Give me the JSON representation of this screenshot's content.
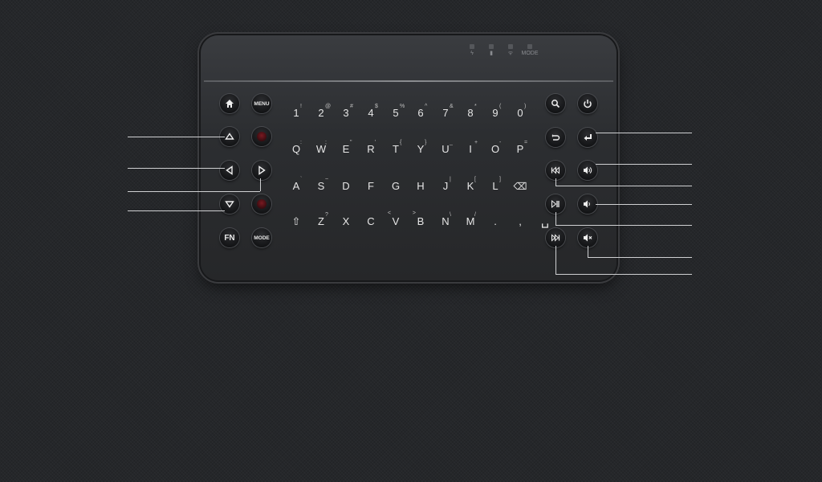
{
  "indicators": [
    {
      "name": "power-led",
      "icon": "plug"
    },
    {
      "name": "battery-led",
      "icon": "battery"
    },
    {
      "name": "wifi-led",
      "icon": "wifi"
    },
    {
      "name": "mode-led",
      "label": "MODE"
    }
  ],
  "left_buttons": {
    "home": "⌂",
    "menu": "MENU",
    "up": "",
    "down": "",
    "left": "",
    "right": "",
    "fn": "FN",
    "mode": "MODE"
  },
  "keyboard": {
    "row1": [
      {
        "k": "1",
        "s": "!"
      },
      {
        "k": "2",
        "s": "@"
      },
      {
        "k": "3",
        "s": "#"
      },
      {
        "k": "4",
        "s": "$"
      },
      {
        "k": "5",
        "s": "%"
      },
      {
        "k": "6",
        "s": "^"
      },
      {
        "k": "7",
        "s": "&"
      },
      {
        "k": "8",
        "s": "*"
      },
      {
        "k": "9",
        "s": "("
      },
      {
        "k": "0",
        "s": ")"
      }
    ],
    "row2": [
      {
        "k": "Q",
        "s": ":"
      },
      {
        "k": "W",
        "s": ";"
      },
      {
        "k": "E",
        "s": "\""
      },
      {
        "k": "R",
        "s": "'"
      },
      {
        "k": "T",
        "s": "{"
      },
      {
        "k": "Y",
        "s": "}"
      },
      {
        "k": "U",
        "s": "_"
      },
      {
        "k": "I",
        "s": "+"
      },
      {
        "k": "O",
        "s": "-"
      },
      {
        "k": "P",
        "s": "="
      }
    ],
    "row3": [
      {
        "k": "A",
        "s": "`"
      },
      {
        "k": "S",
        "s": "~"
      },
      {
        "k": "D",
        "s": ""
      },
      {
        "k": "F",
        "s": ""
      },
      {
        "k": "G",
        "s": ""
      },
      {
        "k": "H",
        "s": ""
      },
      {
        "k": "J",
        "s": "|"
      },
      {
        "k": "K",
        "s": "["
      },
      {
        "k": "L",
        "s": "]"
      },
      {
        "k": "⌫",
        "s": ""
      }
    ],
    "row4": [
      {
        "k": "⇧",
        "s": ""
      },
      {
        "k": "Z",
        "s": "?"
      },
      {
        "k": "X",
        "s": ""
      },
      {
        "k": "C",
        "s": ""
      },
      {
        "k": "V",
        "s": "<"
      },
      {
        "k": "B",
        "s": ">"
      },
      {
        "k": "N",
        "s": "\\"
      },
      {
        "k": "M",
        "s": "/"
      },
      {
        "k": ".",
        "s": ""
      },
      {
        "k": ",",
        "s": ""
      },
      {
        "k": "␣",
        "s": ""
      }
    ]
  },
  "right_buttons": {
    "search": "search-icon",
    "power": "power-icon",
    "back": "back-icon",
    "enter": "enter-icon",
    "prev": "previous-track-icon",
    "vol_up": "volume-up-icon",
    "play": "play-pause-icon",
    "vol_down": "volume-down-icon",
    "next": "next-track-icon",
    "mute": "mute-icon"
  },
  "colors": {
    "accent_red": "#7a1a22",
    "background": "#25272a",
    "device": "#2c2e31"
  }
}
